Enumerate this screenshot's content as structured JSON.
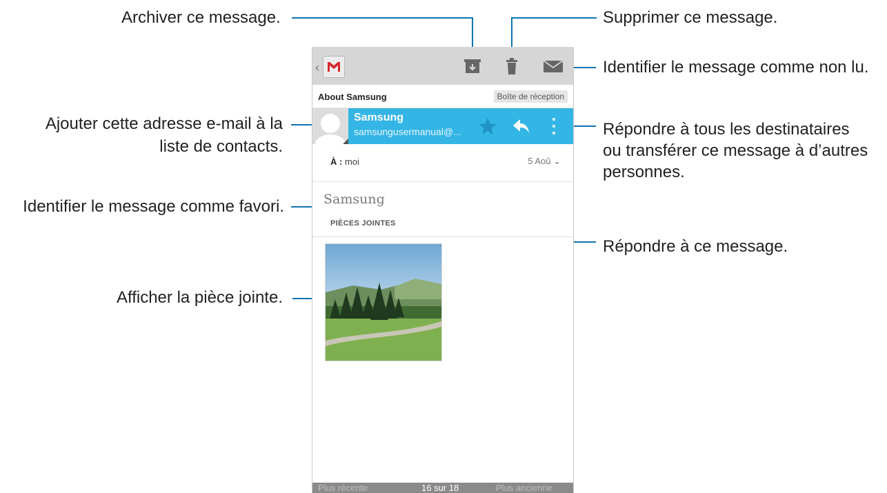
{
  "callouts": {
    "archive": "Archiver ce message.",
    "delete": "Supprimer ce message.",
    "mark_unread": "Identifier le message comme non lu.",
    "add_contact_line1": "Ajouter cette adresse e-mail à la",
    "add_contact_line2": "liste de contacts.",
    "reply_all_line1": "Répondre à tous les destinataires",
    "reply_all_line2": "ou transférer ce message à d’autres",
    "reply_all_line3": "personnes.",
    "star": "Identifier le message comme favori.",
    "reply": "Répondre à ce message.",
    "attachment": "Afficher la pièce jointe."
  },
  "colors": {
    "callout_line": "#0e74b1",
    "sender_bar": "#33b5e5",
    "action_bar": "#d6d6d6"
  },
  "action_bar": {
    "back_icon": "chevron-left-icon",
    "app_icon": "gmail-logo-icon",
    "icons": [
      "archive-icon",
      "trash-icon",
      "mark-unread-icon"
    ]
  },
  "conversation": {
    "subject": "About Samsung",
    "label": "Boîte de réception"
  },
  "sender": {
    "name": "Samsung",
    "email": "samsungusermanual@...",
    "icons": [
      "star-icon",
      "reply-icon",
      "overflow-menu-icon"
    ]
  },
  "recipients": {
    "to_label": "À :",
    "to_value": "moi",
    "date": "5 Aoû"
  },
  "message": {
    "body": "Samsung",
    "attachments_header": "PIÈCES JOINTES"
  },
  "footer": {
    "newer": "Plus récente",
    "position": "16 sur 18",
    "older": "Plus ancienne"
  }
}
